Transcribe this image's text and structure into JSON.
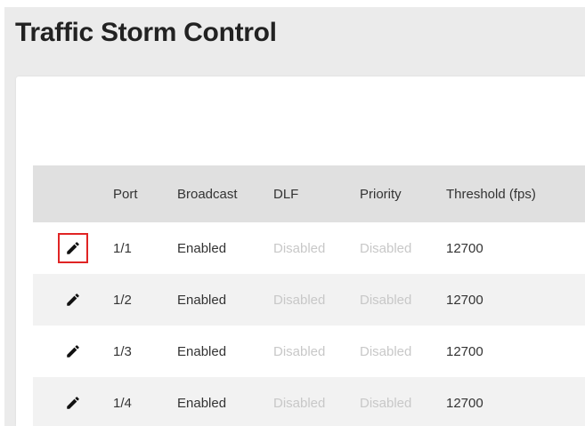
{
  "page": {
    "title": "Traffic Storm Control"
  },
  "table": {
    "columns": {
      "port": "Port",
      "broadcast": "Broadcast",
      "dlf": "DLF",
      "priority": "Priority",
      "threshold": "Threshold (fps)"
    },
    "rows": [
      {
        "port": "1/1",
        "broadcast": "Enabled",
        "dlf": "Disabled",
        "priority": "Disabled",
        "threshold": "12700",
        "edit_icon": "pencil-icon",
        "highlighted": true
      },
      {
        "port": "1/2",
        "broadcast": "Enabled",
        "dlf": "Disabled",
        "priority": "Disabled",
        "threshold": "12700",
        "edit_icon": "pencil-icon",
        "highlighted": false
      },
      {
        "port": "1/3",
        "broadcast": "Enabled",
        "dlf": "Disabled",
        "priority": "Disabled",
        "threshold": "12700",
        "edit_icon": "pencil-icon",
        "highlighted": false
      },
      {
        "port": "1/4",
        "broadcast": "Enabled",
        "dlf": "Disabled",
        "priority": "Disabled",
        "threshold": "12700",
        "edit_icon": "pencil-icon",
        "highlighted": false
      }
    ]
  },
  "colors": {
    "highlight_border": "#e02424",
    "disabled_text": "#c8c8c8",
    "header_bg": "#e0e0e0",
    "stripe_bg": "#f2f2f2"
  }
}
